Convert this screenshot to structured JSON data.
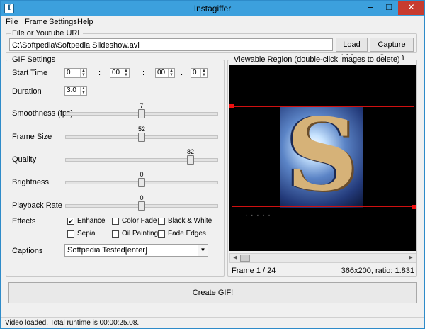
{
  "window": {
    "title": "Instagiffer",
    "icon_letter": "I"
  },
  "menu": [
    "File",
    "Frame",
    "Settings",
    "Help"
  ],
  "source": {
    "group_label": "File or Youtube URL",
    "path_value": "C:\\Softpedia\\Softpedia Slideshow.avi",
    "load_button": "Load Video",
    "capture_button": "Capture Screen"
  },
  "gif": {
    "group_label": "GIF Settings",
    "start_time_label": "Start Time",
    "start_time": {
      "h": "0",
      "m": "00",
      "s": "00",
      "ms": "0"
    },
    "duration_label": "Duration",
    "duration": "3.0",
    "sliders": [
      {
        "label": "Smoothness (fps)",
        "value": "7",
        "level": 0.5
      },
      {
        "label": "Frame Size",
        "value": "52",
        "level": 0.5
      },
      {
        "label": "Quality",
        "value": "82",
        "level": 0.82
      },
      {
        "label": "Brightness",
        "value": "0",
        "level": 0.5
      },
      {
        "label": "Playback Rate",
        "value": "0",
        "level": 0.5
      }
    ],
    "effects_label": "Effects",
    "effects": [
      {
        "label": "Enhance",
        "checked": true
      },
      {
        "label": "Color Fade",
        "checked": false
      },
      {
        "label": "Black & White",
        "checked": false
      },
      {
        "label": "Sepia",
        "checked": false
      },
      {
        "label": "Oil Painting",
        "checked": false
      },
      {
        "label": "Fade Edges",
        "checked": false
      }
    ],
    "captions_label": "Captions",
    "caption_value": "Softpedia Tested[enter]"
  },
  "viewer": {
    "group_label": "Viewable Region (double-click images to delete)",
    "frame_info": "Frame  1 / 24",
    "size_info": "366x200, ratio: 1.831"
  },
  "create_button": "Create GIF!",
  "status": "Video loaded. Total runtime is 00:00:25.08."
}
